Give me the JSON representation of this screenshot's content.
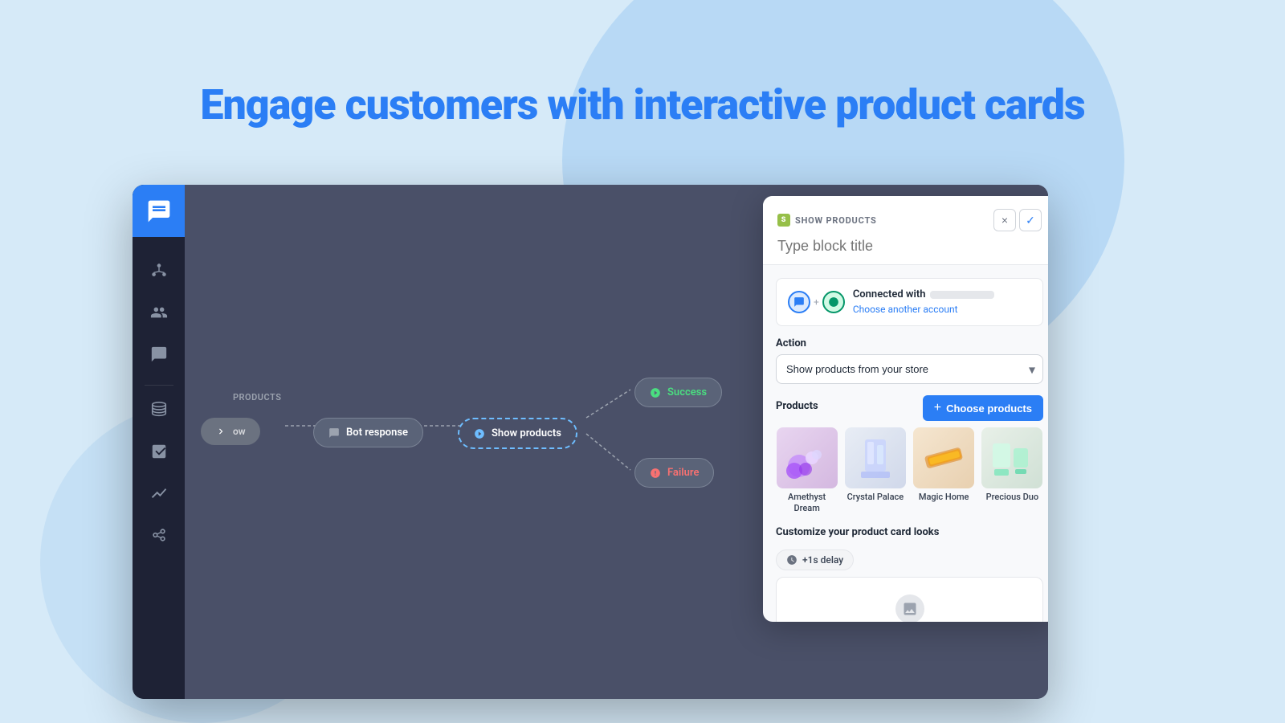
{
  "page": {
    "background_color": "#d6eaf8"
  },
  "heading": {
    "prefix": "Engage customers with ",
    "highlight": "interactive product cards"
  },
  "sidebar": {
    "items": [
      {
        "id": "chat",
        "icon": "chat-icon",
        "label": "Chat"
      },
      {
        "id": "org",
        "icon": "org-icon",
        "label": "Organization"
      },
      {
        "id": "contacts",
        "icon": "contacts-icon",
        "label": "Contacts"
      },
      {
        "id": "conversations",
        "icon": "conversations-icon",
        "label": "Conversations"
      },
      {
        "id": "database",
        "icon": "database-icon",
        "label": "Database"
      },
      {
        "id": "analytics",
        "icon": "analytics-icon",
        "label": "Analytics"
      },
      {
        "id": "trends",
        "icon": "trends-icon",
        "label": "Trends"
      },
      {
        "id": "integrations",
        "icon": "integrations-icon",
        "label": "Integrations"
      }
    ]
  },
  "flow": {
    "block_label": "PRODUCTS",
    "nodes": [
      {
        "id": "flow",
        "label": "Flow",
        "type": "flow"
      },
      {
        "id": "bot-response",
        "label": "Bot response",
        "type": "bot"
      },
      {
        "id": "show-products",
        "label": "Show products",
        "type": "show-products"
      },
      {
        "id": "success",
        "label": "Success",
        "type": "success"
      },
      {
        "id": "failure",
        "label": "Failure",
        "type": "failure"
      }
    ]
  },
  "panel": {
    "block_type_label": "SHOW PRODUCTS",
    "title_placeholder": "Type block title",
    "close_button_label": "×",
    "confirm_button_label": "✓",
    "connected": {
      "label": "Connected with",
      "action_label": "Choose another account"
    },
    "action": {
      "section_label": "Action",
      "options": [
        "Show products from your store"
      ],
      "selected": "Show products from your store"
    },
    "products": {
      "section_label": "Products",
      "choose_button_label": "Choose products",
      "items": [
        {
          "id": "amethyst",
          "name": "Amethyst Dream",
          "bg": "amethyst"
        },
        {
          "id": "crystal",
          "name": "Crystal Palace",
          "bg": "crystal"
        },
        {
          "id": "magic",
          "name": "Magic Home",
          "bg": "magic"
        },
        {
          "id": "precious",
          "name": "Precious Duo",
          "bg": "precious"
        }
      ]
    },
    "customize": {
      "section_label": "Customize your product card looks",
      "delay_label": "+1s delay"
    }
  }
}
